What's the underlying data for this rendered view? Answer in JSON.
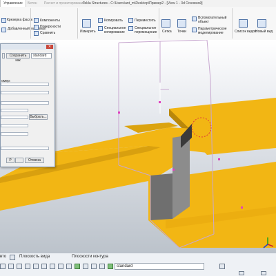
{
  "window": {
    "title": "Tekla Structures - C:\\Users\\ant_m\\Desktop\\Пример2 - [View 1 - 3d Основной]",
    "tabs": [
      {
        "label": "Управление",
        "active": true
      },
      {
        "label": "Бетон",
        "active": false
      },
      {
        "label": "Расчет и проектирование",
        "active": false
      }
    ]
  },
  "ribbon": {
    "items": {
      "part_cut": "Крезерка фасок",
      "add_material": "Добавленный материал",
      "components": "Компоненты",
      "surfaces": "Поверхности",
      "compare": "Сравнить",
      "measure": "Измерить",
      "copy": "Копировать",
      "special_copy": "Специальное копирование",
      "move": "Переместить",
      "special_move": "Специальное перемещение",
      "grid": "Сетка",
      "points": "Точки",
      "aux_object": "Вспомогательный объект",
      "param_modeling": "Параметрическое моделирование",
      "view_list": "Список видов",
      "new_view": "Новый вид"
    }
  },
  "dialog": {
    "save_as_label": "Сохранить как",
    "preset_value": "standard",
    "partial_label": "омер:",
    "select_button": "Выбрать...",
    "cancel_button": "Отмена",
    "icon_p": "P"
  },
  "statusbar": {
    "view_plane": "Плоскость вида",
    "contour_planes": "Плоскости контура",
    "filter_value": "standard",
    "partial_left": "вто"
  },
  "colors": {
    "slab": "#f2b614",
    "slab_edge": "#b9870a",
    "opening_wire": "#c8a8d0",
    "accent": "#4a6fa5"
  }
}
